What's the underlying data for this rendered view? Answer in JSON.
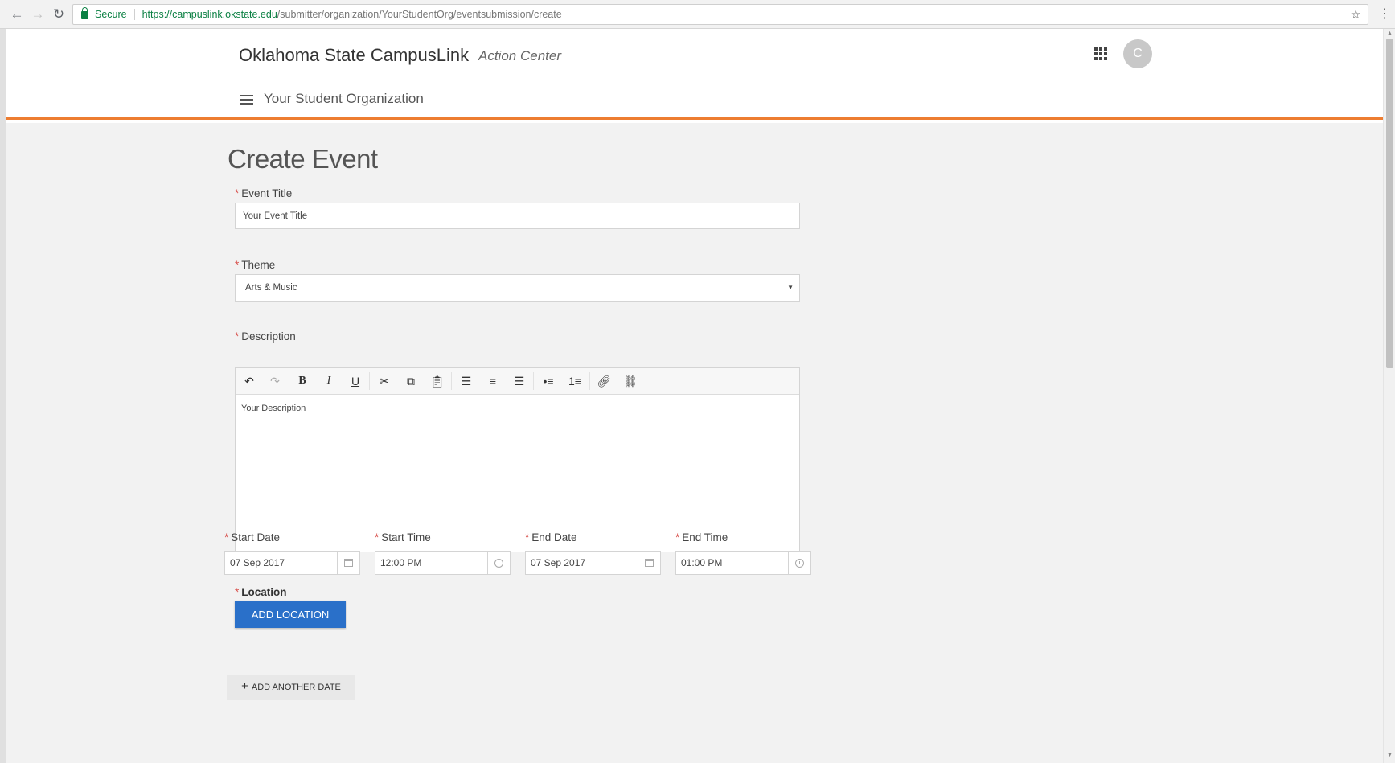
{
  "browser": {
    "secure_label": "Secure",
    "url_proto": "https://",
    "url_host": "campuslink.okstate.edu",
    "url_path": "/submitter/organization/YourStudentOrg/eventsubmission/create"
  },
  "header": {
    "title": "Oklahoma State CampusLink",
    "subtitle": "Action Center",
    "avatar_initial": "C",
    "org_name": "Your Student Organization"
  },
  "page": {
    "title": "Create Event"
  },
  "form": {
    "event_title": {
      "label": "Event Title",
      "value": "Your Event Title"
    },
    "theme": {
      "label": "Theme",
      "value": "Arts & Music"
    },
    "description": {
      "label": "Description",
      "value": "Your Description"
    },
    "start_date": {
      "label": "Start Date",
      "value": "07 Sep 2017"
    },
    "start_time": {
      "label": "Start Time",
      "value": "12:00 PM"
    },
    "end_date": {
      "label": "End Date",
      "value": "07 Sep 2017"
    },
    "end_time": {
      "label": "End Time",
      "value": "01:00 PM"
    },
    "location": {
      "label": "Location",
      "button": "ADD LOCATION"
    },
    "add_date": {
      "button": "ADD ANOTHER DATE"
    },
    "required_marker": "*"
  },
  "toolbar": {
    "icons": [
      "undo-icon",
      "redo-icon",
      "bold-icon",
      "italic-icon",
      "underline-icon",
      "cut-icon",
      "copy-icon",
      "paste-icon",
      "align-left-icon",
      "align-center-icon",
      "align-right-icon",
      "bulleted-list-icon",
      "numbered-list-icon",
      "link-icon",
      "unlink-icon"
    ]
  },
  "colors": {
    "accent_orange": "#ed7d31",
    "primary_blue": "#2a70c9",
    "required_red": "#d9534f"
  }
}
